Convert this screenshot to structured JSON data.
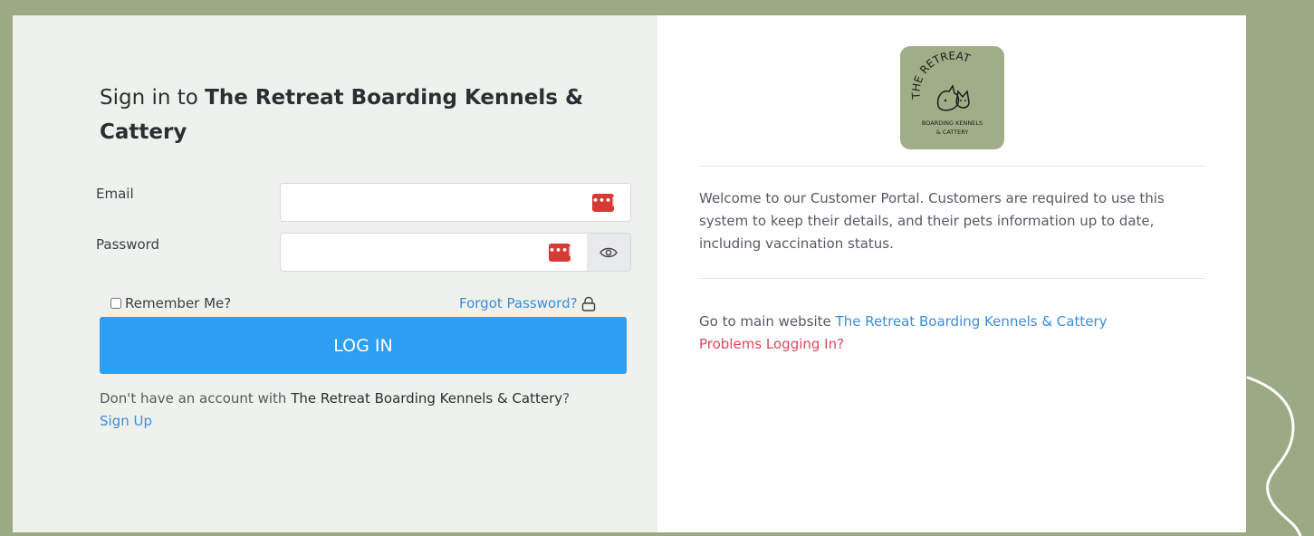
{
  "header": {
    "title_prefix": "Sign in to",
    "title_business": "The Retreat Boarding Kennels & Cattery"
  },
  "form": {
    "email_label": "Email",
    "email_value": "",
    "password_label": "Password",
    "password_value": "",
    "password_manager_icon": "•••|",
    "remember_label": "Remember Me?",
    "forgot_label": "Forgot Password?",
    "login_label": "LOG IN"
  },
  "signup": {
    "text_prefix": "Don't have an account with",
    "business": "The Retreat Boarding Kennels & Cattery",
    "text_suffix": "?",
    "link_label": "Sign Up"
  },
  "logo": {
    "arc_text": "THE RETREAT",
    "line1": "BOARDING KENNELS",
    "line2": "& CATTERY"
  },
  "welcome": {
    "text": "Welcome to our Customer Portal. Customers are required to use this system to keep their details, and their pets information up to date, including vaccination status."
  },
  "links": {
    "goto_prefix": "Go to main website",
    "main_website": "The Retreat Boarding Kennels & Cattery",
    "problems": "Problems Logging In?"
  },
  "colors": {
    "frame": "#9aaa82",
    "primary_button": "#2d9ef2",
    "link": "#3a8ddc",
    "problems_link": "#e0455a",
    "password_manager": "#d63a32"
  }
}
